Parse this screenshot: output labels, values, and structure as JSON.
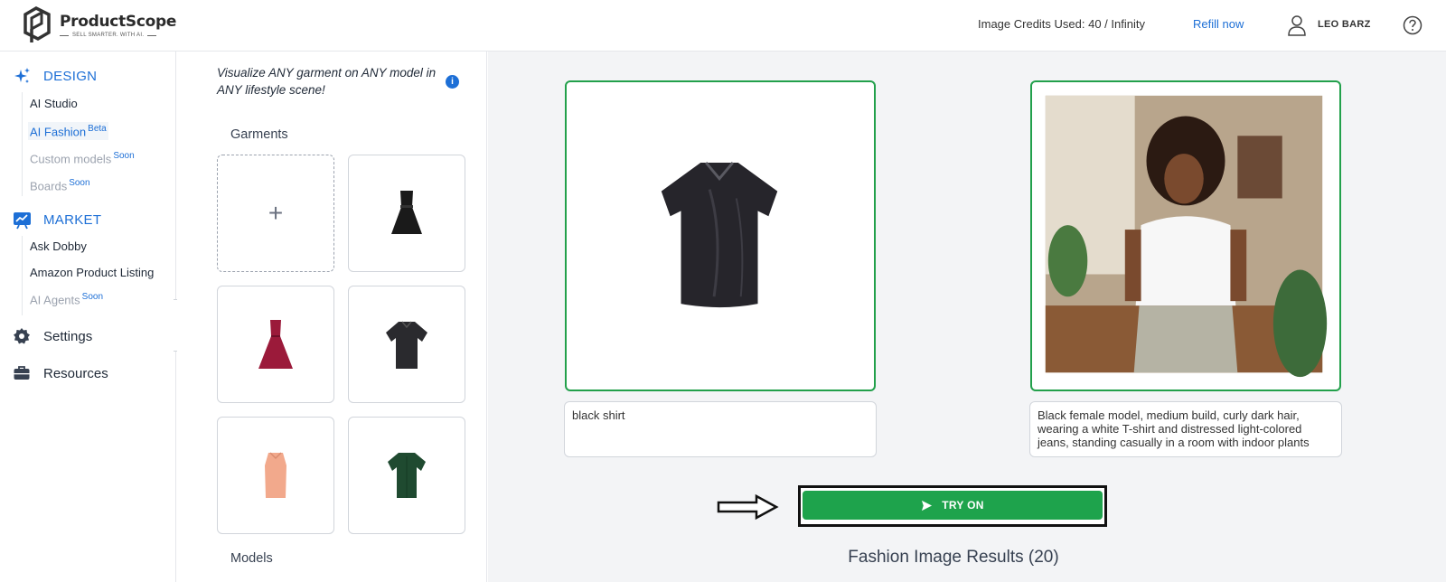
{
  "header": {
    "brand_name": "ProductScope",
    "brand_tagline": "SELL SMARTER. WITH AI.",
    "credits_text": "Image Credits Used: 40 / Infinity",
    "refill_label": "Refill now",
    "user_name": "LEO BARZ"
  },
  "sidebar": {
    "design": {
      "title": "DESIGN",
      "items": [
        {
          "label": "AI Studio",
          "badge": ""
        },
        {
          "label": "AI Fashion",
          "badge": "Beta"
        },
        {
          "label": "Custom models",
          "badge": "Soon"
        },
        {
          "label": "Boards",
          "badge": "Soon"
        }
      ]
    },
    "market": {
      "title": "MARKET",
      "items": [
        {
          "label": "Ask Dobby",
          "badge": ""
        },
        {
          "label": "Amazon Product Listing",
          "badge": ""
        },
        {
          "label": "AI Agents",
          "badge": "Soon"
        }
      ]
    },
    "settings_label": "Settings",
    "resources_label": "Resources"
  },
  "panel": {
    "intro": "Visualize ANY garment on ANY model in ANY lifestyle scene!",
    "garments_label": "Garments",
    "add_symbol": "+",
    "models_label": "Models"
  },
  "main": {
    "garment_description": "black shirt",
    "model_description": "Black female model, medium build, curly dark hair, wearing a white T-shirt and distressed light-colored jeans, standing casually in a room with indoor plants",
    "try_on_label": "TRY ON",
    "results_title": "Fashion Image Results (20)"
  },
  "colors": {
    "accent_blue": "#1d6fd6",
    "try_on_green": "#1ea34c",
    "frame_green": "#22a04b"
  }
}
